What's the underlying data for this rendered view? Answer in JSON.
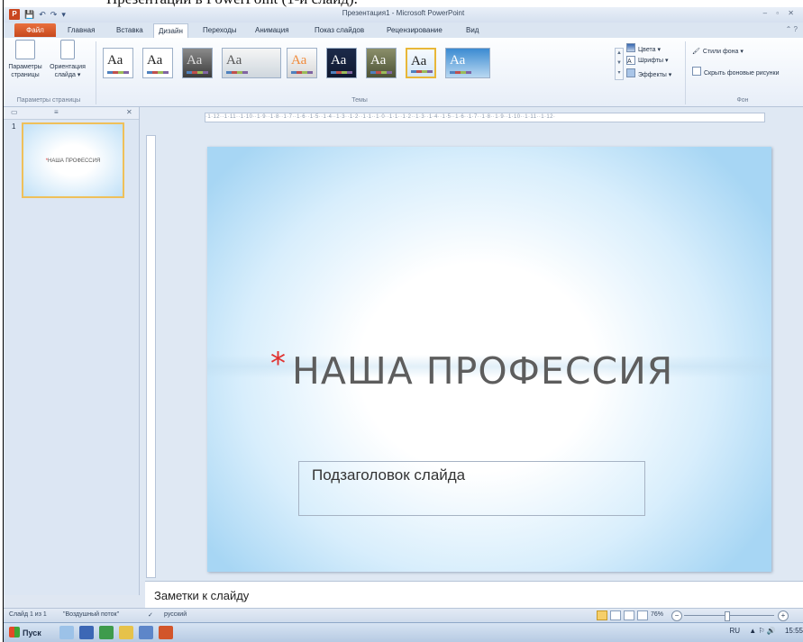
{
  "doc_line": "Презентации в PowerPoint (1-й слайд).",
  "window": {
    "title": "Презентация1 - Microsoft PowerPoint",
    "controls": "– ▫ ✕"
  },
  "tabs": [
    {
      "label": "Файл"
    },
    {
      "label": "Главная"
    },
    {
      "label": "Вставка"
    },
    {
      "label": "Дизайн"
    },
    {
      "label": "Переходы"
    },
    {
      "label": "Анимация"
    },
    {
      "label": "Показ слайдов"
    },
    {
      "label": "Рецензирование"
    },
    {
      "label": "Вид"
    }
  ],
  "ribbon": {
    "page_setup_label": "Параметры страницы",
    "orientation_label": "Ориентация слайда ▾",
    "page_params_group": "Параметры страницы",
    "theme_sample": "Аа",
    "themes_group": "Темы",
    "colors": "Цвета ▾",
    "fonts": "Шрифты ▾",
    "effects": "Эффекты ▾",
    "bg_styles": "Стили фона ▾",
    "hide_bg": "Скрыть фоновые рисунки",
    "bg_group": "Фон"
  },
  "left_pane": {
    "slide_number": "1",
    "thumb_title": "НАША ПРОФЕССИЯ",
    "close": "✕"
  },
  "ruler_text": "·1·12··1·11··1·10··1·9··1·8··1·7··1·6··1·5··1·4··1·3··1·2··1·1··1·0··1·1··1·2··1·3··1·4··1·5··1·6··1·7··1·8··1·9··1·10··1·11··1·12·",
  "slide": {
    "title": "НАША ПРОФЕССИЯ",
    "subtitle_placeholder": "Подзаголовок слайда"
  },
  "notes_placeholder": "Заметки к слайду",
  "status": {
    "slide_info": "Слайд 1 из 1",
    "theme_name": "\"Воздушный поток\"",
    "language": "русский",
    "zoom": "76%"
  },
  "taskbar": {
    "start": "Пуск",
    "lang": "RU",
    "time": "15:55"
  },
  "colors": {
    "accent_file_tab": "#c6481c",
    "title_asterisk": "#e0312f",
    "selected_theme_border": "#e8b738"
  }
}
